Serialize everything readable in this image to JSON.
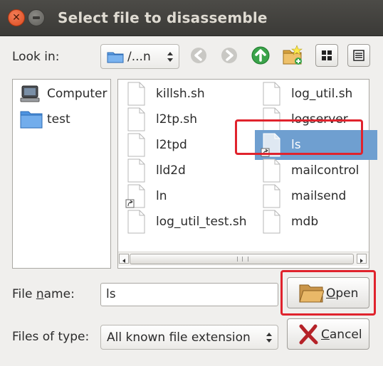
{
  "window": {
    "title": "Select file to disassemble"
  },
  "look_in": {
    "label": "Look in:",
    "path": "/...n"
  },
  "toolbar": [
    "back-icon",
    "forward-icon",
    "parent-dir-icon",
    "new-folder-icon",
    "list-view-icon",
    "detail-view-icon"
  ],
  "places": [
    {
      "label": "Computer",
      "icon": "computer-icon"
    },
    {
      "label": "test",
      "icon": "folder-icon"
    }
  ],
  "files": [
    {
      "name": "killsh.sh"
    },
    {
      "name": "l2tp.sh"
    },
    {
      "name": "l2tpd"
    },
    {
      "name": "lld2d"
    },
    {
      "name": "ln"
    },
    {
      "name": "log_util_test.sh"
    },
    {
      "name": "log_util.sh"
    },
    {
      "name": "logserver"
    },
    {
      "name": "ls"
    },
    {
      "name": "mailcontrol"
    },
    {
      "name": "mailsend"
    },
    {
      "name": "mdb"
    }
  ],
  "selected_file": "ls",
  "file_name": {
    "label_pre": "File ",
    "label_mnemonic": "n",
    "label_post": "ame:",
    "value": "ls"
  },
  "file_type": {
    "label": "Files of type:",
    "value": "All known file extension"
  },
  "buttons": {
    "open": {
      "mnemonic": "O",
      "rest": "pen"
    },
    "cancel": {
      "mnemonic": "C",
      "rest": "ancel"
    }
  },
  "colors": {
    "selection": "#6f9fd0",
    "highlight_box": "#e0232d",
    "titlebar": "#3b3a37"
  }
}
